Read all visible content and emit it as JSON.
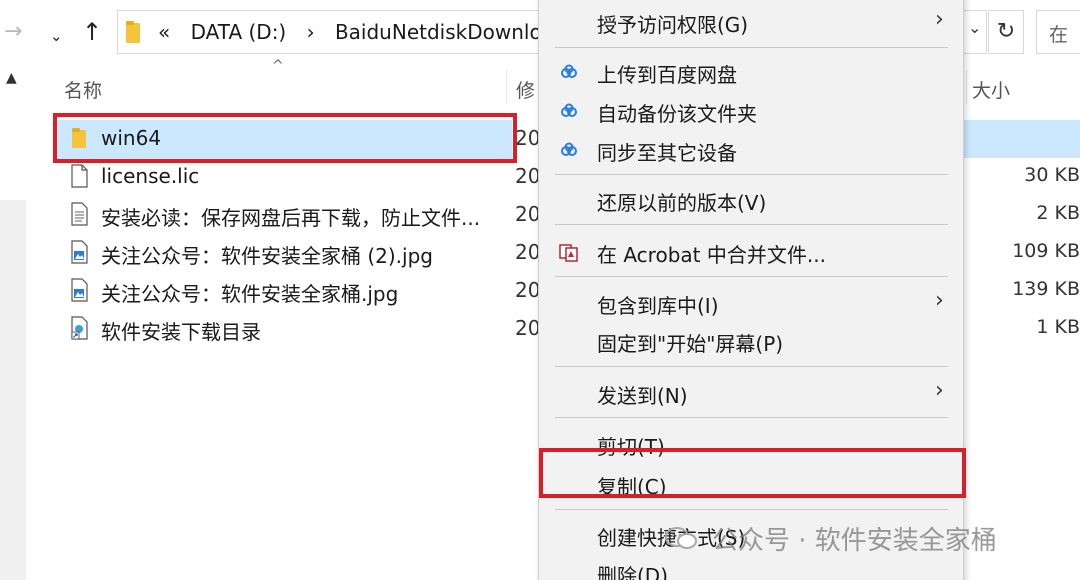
{
  "address_bar": {
    "overflow_glyph": "«",
    "path": [
      "DATA (D:)",
      "›",
      "BaiduNetdiskDownloa"
    ],
    "search_placeholder": "在"
  },
  "columns": {
    "name": "名称",
    "modified": "修",
    "size": "大小"
  },
  "files": [
    {
      "name": "win64",
      "date": "20",
      "size": "",
      "icon": "folder-icon",
      "selected": true
    },
    {
      "name": "license.lic",
      "date": "20",
      "size": "30 KB",
      "icon": "file-icon"
    },
    {
      "name": "安装必读：保存网盘后再下载，防止文件...",
      "date": "20",
      "size": "2 KB",
      "icon": "text-file-icon"
    },
    {
      "name": "关注公众号：软件安装全家桶 (2).jpg",
      "date": "20",
      "size": "109 KB",
      "icon": "image-file-icon"
    },
    {
      "name": "关注公众号：软件安装全家桶.jpg",
      "date": "20",
      "size": "139 KB",
      "icon": "image-file-icon"
    },
    {
      "name": "软件安装下载目录",
      "date": "20",
      "size": "1 KB",
      "icon": "shortcut-icon"
    }
  ],
  "context_menu": {
    "items": [
      {
        "label": "授予访问权限(G)",
        "submenu": true
      },
      {
        "label": "上传到百度网盘",
        "icon": "baidu-netdisk-icon"
      },
      {
        "label": "自动备份该文件夹",
        "icon": "baidu-netdisk-icon"
      },
      {
        "label": "同步至其它设备",
        "icon": "baidu-netdisk-icon"
      },
      {
        "label": "还原以前的版本(V)"
      },
      {
        "label": "在 Acrobat 中合并文件...",
        "icon": "acrobat-icon"
      },
      {
        "label": "包含到库中(I)",
        "submenu": true
      },
      {
        "label": "固定到\"开始\"屏幕(P)"
      },
      {
        "label": "发送到(N)",
        "submenu": true
      },
      {
        "label": "剪切(T)"
      },
      {
        "label": "复制(C)"
      },
      {
        "label": "创建快捷方式(S)"
      },
      {
        "label": "删除(D)"
      }
    ]
  },
  "watermark": {
    "text": "公众号 · 软件安装全家桶"
  },
  "colors": {
    "highlight": "#d8202a",
    "selection": "#cce8ff",
    "menu_bg": "#f2f2f2"
  }
}
